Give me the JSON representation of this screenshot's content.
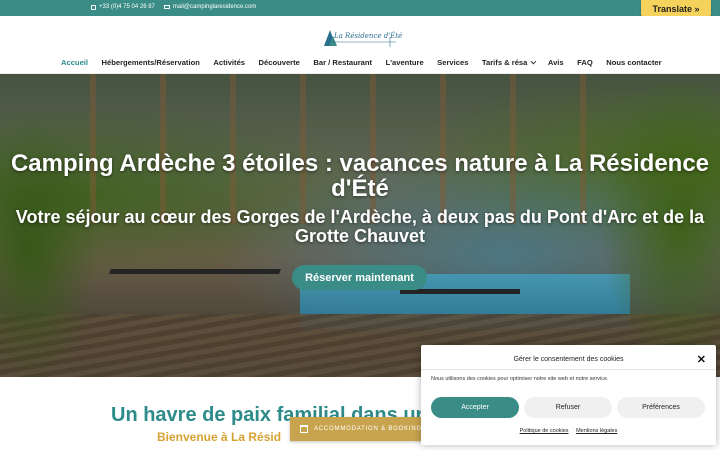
{
  "topbar": {
    "phone": "+33 (0)4 75 04 26 87",
    "email": "mail@campinglaresidence.com",
    "translate_label": "Translate »"
  },
  "header": {
    "logo_text": "La Résidence d'Été",
    "nav": [
      {
        "label": "Accueil",
        "active": true
      },
      {
        "label": "Hébergements/Réservation"
      },
      {
        "label": "Activités"
      },
      {
        "label": "Découverte"
      },
      {
        "label": "Bar / Restaurant"
      },
      {
        "label": "L'aventure"
      },
      {
        "label": "Services"
      },
      {
        "label": "Tarifs & résa",
        "dropdown": true
      },
      {
        "label": "Avis"
      },
      {
        "label": "FAQ"
      },
      {
        "label": "Nous contacter"
      }
    ]
  },
  "hero": {
    "title": "Camping Ardèche 3 étoiles : vacances nature à La Résidence d'Été",
    "subtitle": "Votre séjour au cœur des Gorges de l'Ardèche, à deux pas du Pont d'Arc et de la Grotte Chauvet",
    "cta_label": "Réserver maintenant"
  },
  "intro": {
    "heading": "Un havre de paix familial dans un",
    "subheading": "Bienvenue à La Résid"
  },
  "booking_bar": {
    "label": "ACCOMMODATION & BOOKING"
  },
  "cookie": {
    "title": "Gérer le consentement des cookies",
    "description": "Nous utilisons des cookies pour optimiser notre site web et notre service.",
    "accept": "Accepter",
    "refuse": "Refuser",
    "preferences": "Préférences",
    "link_policy": "Politique de cookies",
    "link_legal": "Mentions légales"
  },
  "colors": {
    "brand_teal": "#3a8c87",
    "gold": "#d6a232",
    "translate_yellow": "#f5d25b"
  }
}
